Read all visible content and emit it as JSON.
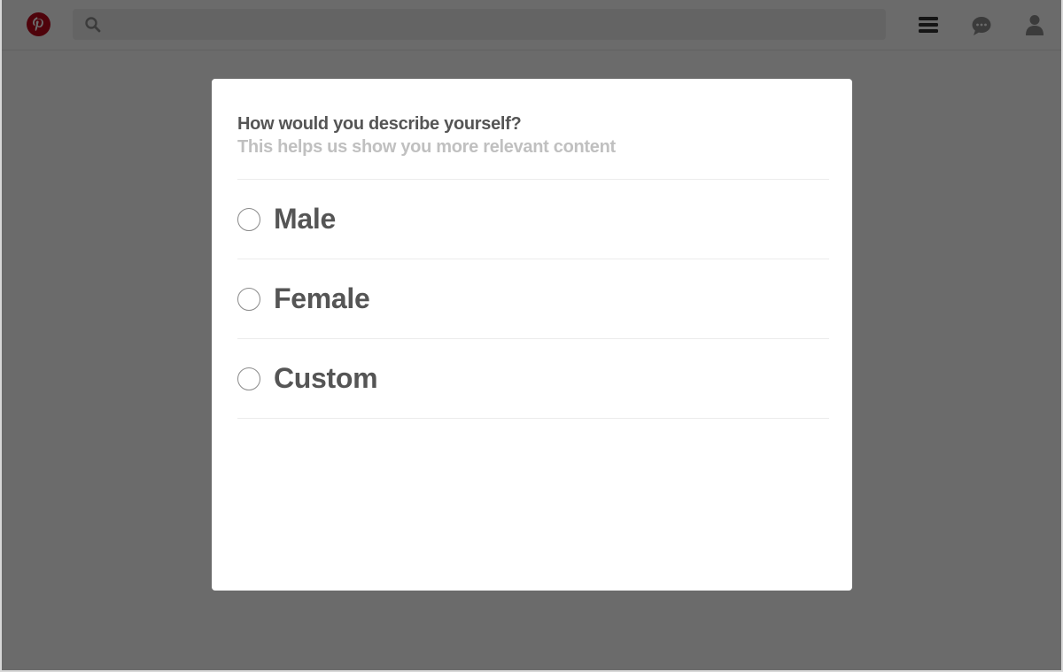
{
  "header": {
    "logo_icon": "pinterest-logo-icon",
    "search": {
      "placeholder": "",
      "icon": "search-icon"
    },
    "nav_icons": [
      "menu-icon",
      "messages-icon",
      "profile-icon"
    ]
  },
  "modal": {
    "title": "How would you describe yourself?",
    "subtitle": "This helps us show you more relevant content",
    "options": [
      {
        "label": "Male",
        "selected": false
      },
      {
        "label": "Female",
        "selected": false
      },
      {
        "label": "Custom",
        "selected": false
      }
    ]
  },
  "colors": {
    "brand_red": "#bd081c",
    "overlay": "#6a6a6a",
    "title_text": "#555555",
    "subtitle_text": "#c0c0c0"
  }
}
